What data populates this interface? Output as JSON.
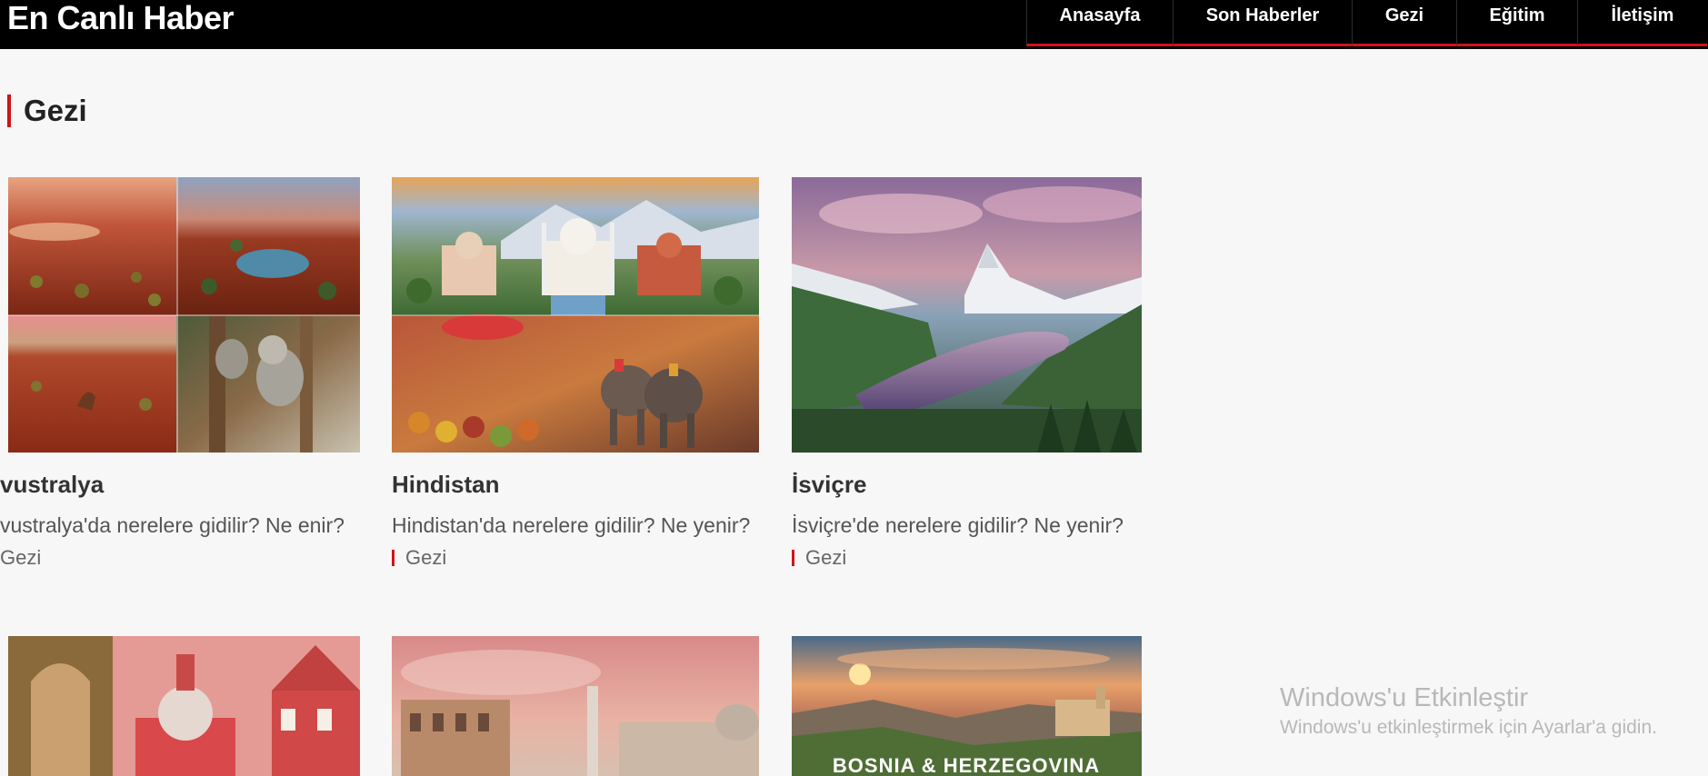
{
  "site": {
    "title": "En Canlı Haber"
  },
  "nav": [
    {
      "label": "Anasayfa"
    },
    {
      "label": "Son Haberler"
    },
    {
      "label": "Gezi"
    },
    {
      "label": "Eğitim"
    },
    {
      "label": "İletişim"
    }
  ],
  "section": {
    "title": "Gezi"
  },
  "cards": [
    {
      "title": "vustralya",
      "desc": "vustralya'da nerelere gidilir? Ne enir?",
      "category": "Gezi"
    },
    {
      "title": "Hindistan",
      "desc": "Hindistan'da nerelere gidilir? Ne yenir?",
      "category": "Gezi"
    },
    {
      "title": "İsviçre",
      "desc": "İsviçre'de nerelere gidilir? Ne yenir?",
      "category": "Gezi"
    }
  ],
  "cards_row2": [
    {
      "overlay": ""
    },
    {
      "overlay": ""
    },
    {
      "overlay": "BOSNIA & HERZEGOVINA"
    }
  ],
  "watermark": {
    "line1": "Windows'u Etkinleştir",
    "line2": "Windows'u etkinleştirmek için Ayarlar'a gidin."
  },
  "colors": {
    "accent": "#d0121b",
    "header_bg": "#000000",
    "page_bg": "#f7f7f7"
  }
}
